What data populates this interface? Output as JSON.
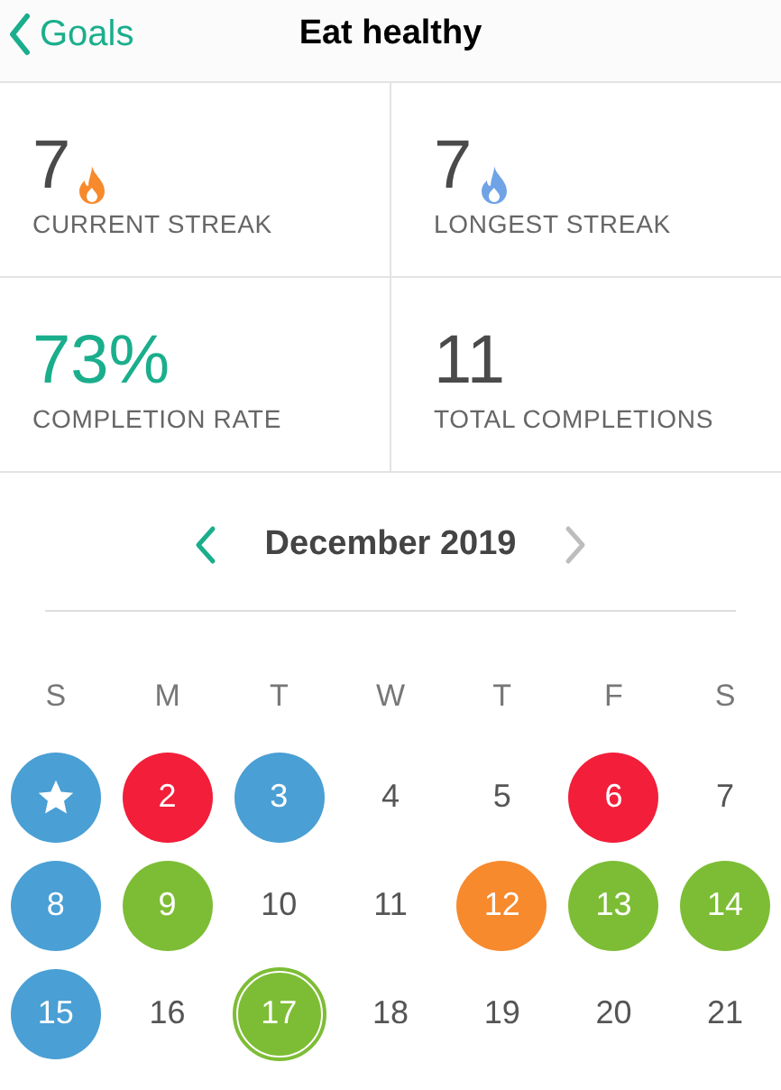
{
  "nav": {
    "back": "Goals",
    "title": "Eat healthy"
  },
  "stats": [
    {
      "kind": "streak",
      "value": "7",
      "label": "CURRENT STREAK",
      "color": "#f78a2d"
    },
    {
      "kind": "streak",
      "value": "7",
      "label": "LONGEST STREAK",
      "color": "#6fa3e6"
    },
    {
      "kind": "rate",
      "value": "73%",
      "label": "COMPLETION RATE",
      "color": "#1aae8c"
    },
    {
      "kind": "count",
      "value": "11",
      "label": "TOTAL COMPLETIONS"
    }
  ],
  "calendar": {
    "month": "December 2019",
    "weekdays": [
      "S",
      "M",
      "T",
      "W",
      "T",
      "F",
      "S"
    ],
    "days": [
      {
        "kind": "star",
        "color": "#4a9fd4",
        "selected": false
      },
      {
        "kind": "number",
        "label": "2",
        "color": "#f21e3a",
        "selected": false
      },
      {
        "kind": "number",
        "label": "3",
        "color": "#4a9fd4",
        "selected": false
      },
      {
        "kind": "number",
        "label": "4",
        "selected": false
      },
      {
        "kind": "number",
        "label": "5",
        "selected": false
      },
      {
        "kind": "number",
        "label": "6",
        "color": "#f21e3a",
        "selected": false
      },
      {
        "kind": "number",
        "label": "7",
        "selected": false
      },
      {
        "kind": "number",
        "label": "8",
        "color": "#4a9fd4",
        "selected": false
      },
      {
        "kind": "number",
        "label": "9",
        "color": "#7dbd35",
        "selected": false
      },
      {
        "kind": "number",
        "label": "10",
        "selected": false
      },
      {
        "kind": "number",
        "label": "11",
        "selected": false
      },
      {
        "kind": "number",
        "label": "12",
        "color": "#f78a2d",
        "selected": false
      },
      {
        "kind": "number",
        "label": "13",
        "color": "#7dbd35",
        "selected": false
      },
      {
        "kind": "number",
        "label": "14",
        "color": "#7dbd35",
        "selected": false
      },
      {
        "kind": "number",
        "label": "15",
        "color": "#4a9fd4",
        "selected": false
      },
      {
        "kind": "number",
        "label": "16",
        "selected": false
      },
      {
        "kind": "number",
        "label": "17",
        "color": "#7dbd35",
        "selected": true
      },
      {
        "kind": "number",
        "label": "18",
        "selected": false
      },
      {
        "kind": "number",
        "label": "19",
        "selected": false
      },
      {
        "kind": "number",
        "label": "20",
        "selected": false
      },
      {
        "kind": "number",
        "label": "21",
        "selected": false
      }
    ]
  }
}
